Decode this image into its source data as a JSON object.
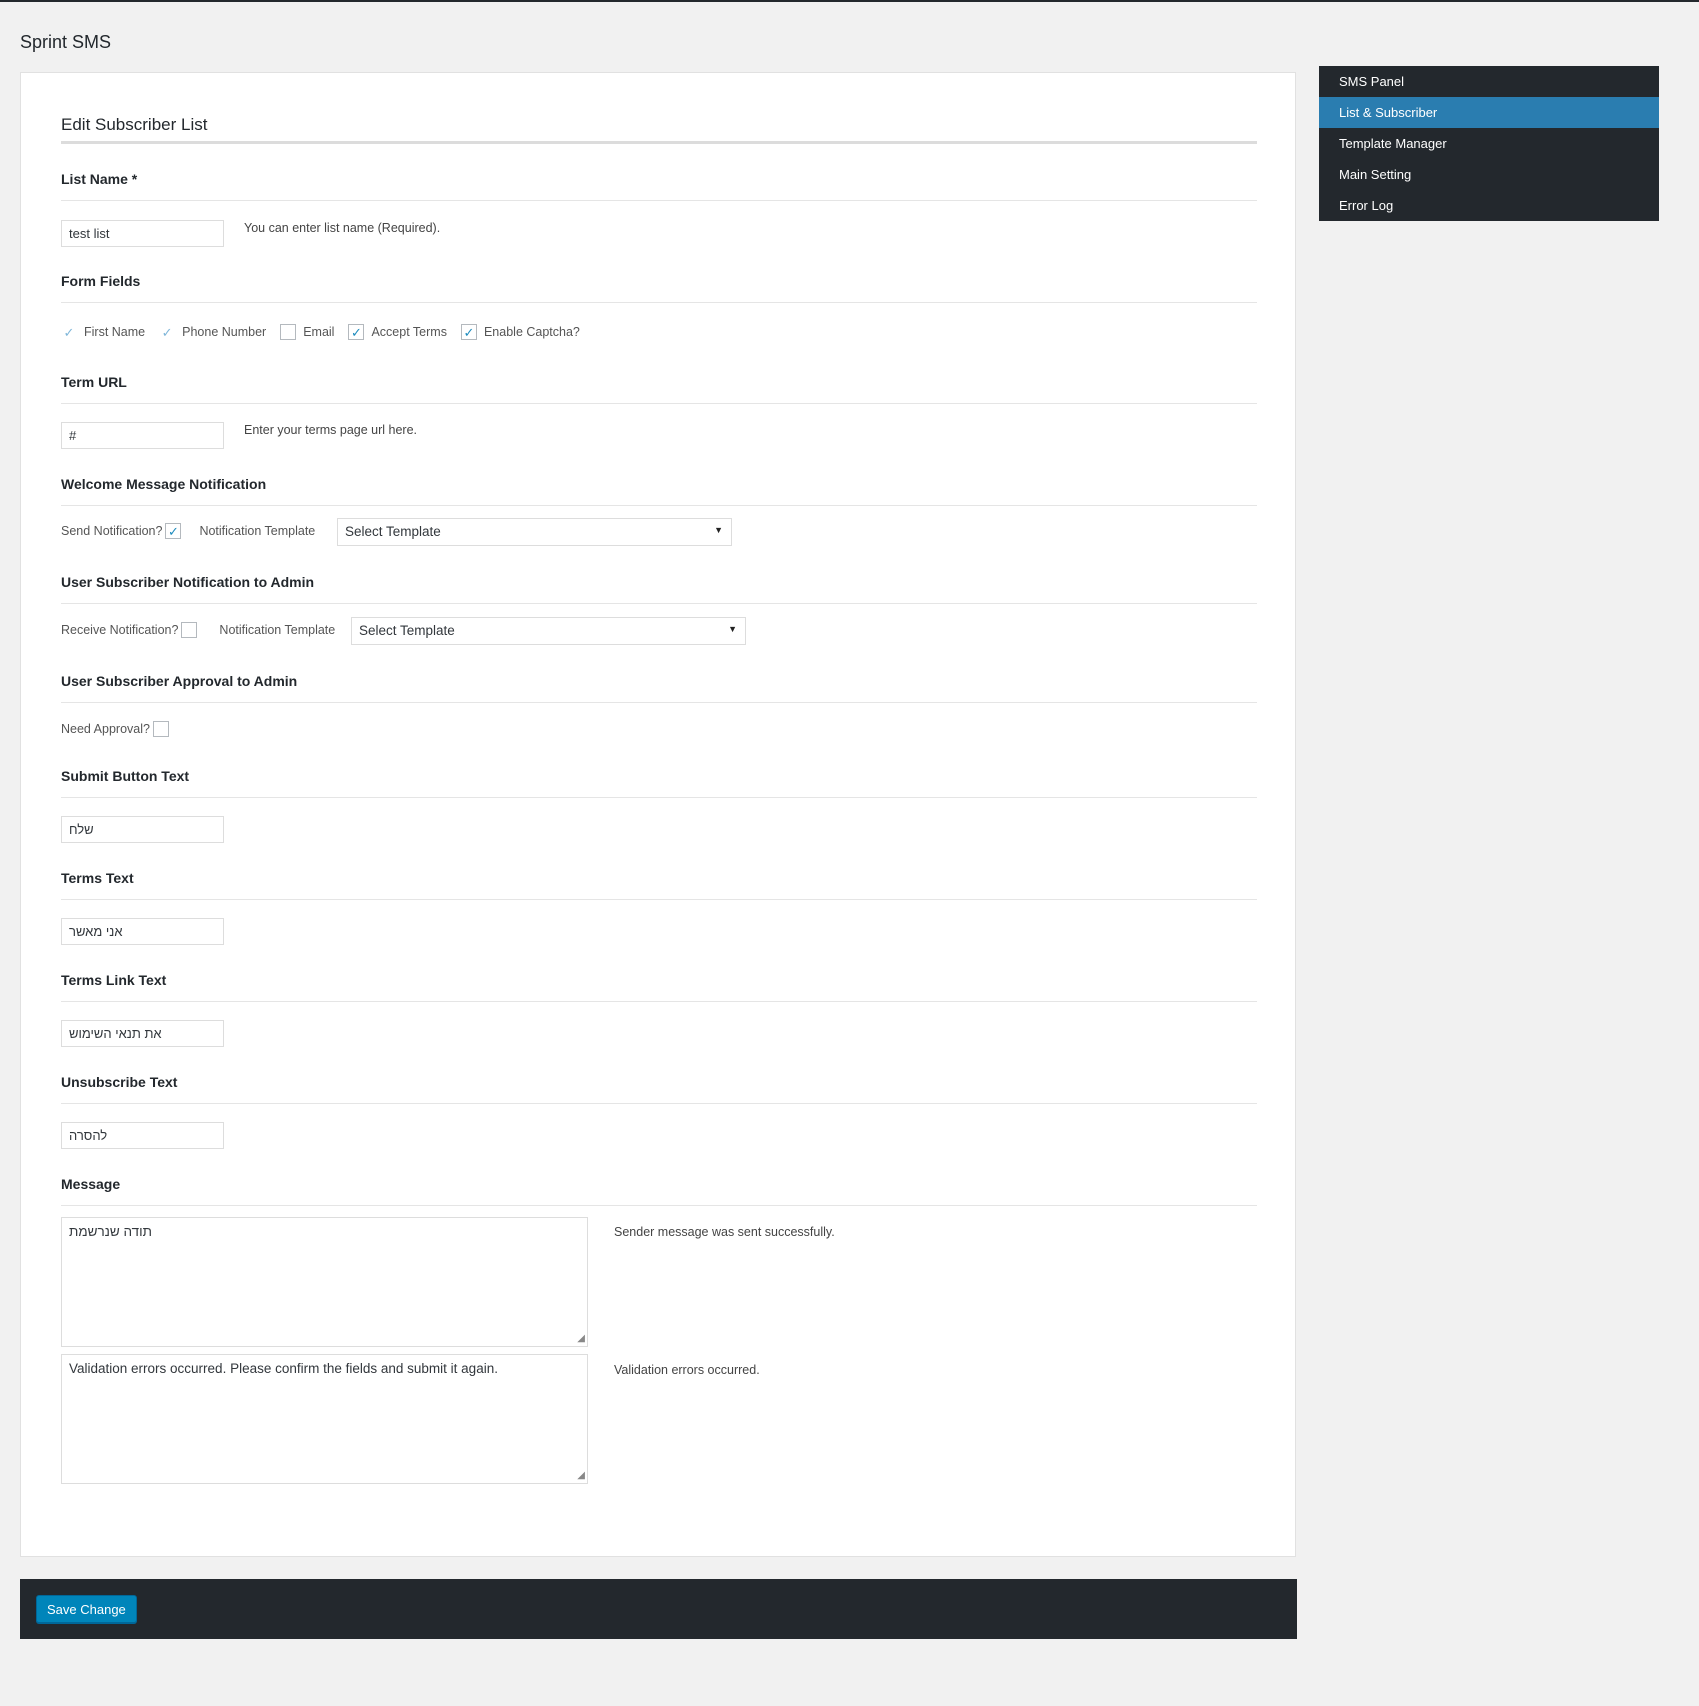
{
  "app": {
    "title": "Sprint SMS"
  },
  "sidebar": {
    "items": [
      {
        "label": "SMS Panel",
        "active": false
      },
      {
        "label": "List & Subscriber",
        "active": true
      },
      {
        "label": "Template Manager",
        "active": false
      },
      {
        "label": "Main Setting",
        "active": false
      },
      {
        "label": "Error Log",
        "active": false
      }
    ]
  },
  "form": {
    "heading": "Edit Subscriber List",
    "list_name": {
      "title": "List Name *",
      "value": "test list",
      "hint": "You can enter list name (Required)."
    },
    "form_fields": {
      "title": "Form Fields",
      "options": [
        {
          "label": "First Name",
          "checked": true
        },
        {
          "label": "Phone Number",
          "checked": true
        },
        {
          "label": "Email",
          "checked": false
        },
        {
          "label": "Accept Terms",
          "checked": true
        },
        {
          "label": "Enable Captcha?",
          "checked": true
        }
      ]
    },
    "term_url": {
      "title": "Term URL",
      "value": "#",
      "hint": "Enter your terms page url here."
    },
    "welcome": {
      "title": "Welcome Message Notification",
      "checkbox_label": "Send Notification?",
      "checked": true,
      "template_label": "Notification Template",
      "template_value": "Select Template"
    },
    "admin_notification": {
      "title": "User Subscriber Notification to Admin",
      "checkbox_label": "Receive Notification?",
      "checked": false,
      "template_label": "Notification Template",
      "template_value": "Select Template"
    },
    "approval": {
      "title": "User Subscriber Approval to Admin",
      "checkbox_label": "Need Approval?",
      "checked": false
    },
    "submit_text": {
      "title": "Submit Button Text",
      "value": "שלח"
    },
    "terms_text": {
      "title": "Terms Text",
      "value": "אני מאשר"
    },
    "terms_link_text": {
      "title": "Terms Link Text",
      "value": "את תנאי השימוש"
    },
    "unsubscribe_text": {
      "title": "Unsubscribe Text",
      "value": "להסרה"
    },
    "message": {
      "title": "Message",
      "success_value": "תודה שנרשמת",
      "success_hint": "Sender message was sent successfully.",
      "error_value": "Validation errors occurred. Please confirm the fields and submit it again.",
      "error_hint": "Validation errors occurred."
    }
  },
  "footer": {
    "save_label": "Save Change"
  },
  "icons": {
    "check": "✓",
    "arrow": "▼",
    "grip": "◢"
  },
  "colors": {
    "accent": "#2a7db0",
    "dark": "#23282d",
    "button": "#0085ba"
  }
}
